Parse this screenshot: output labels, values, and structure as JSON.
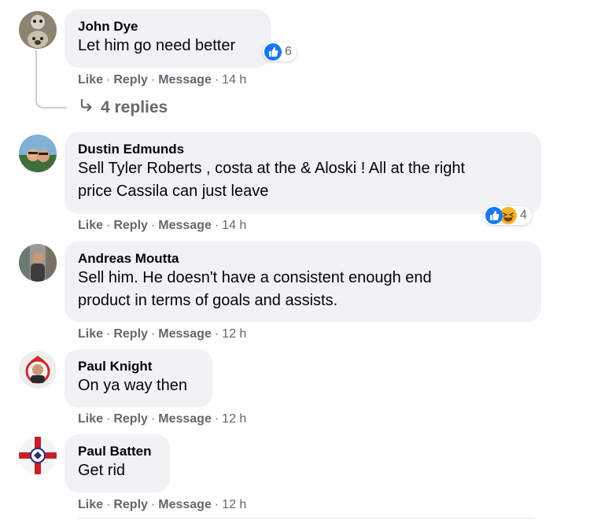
{
  "actions": {
    "like": "Like",
    "reply": "Reply",
    "message": "Message",
    "dot": "·"
  },
  "colors": {
    "bubble": "#f0f2f5",
    "meta": "#65676b",
    "like_blue": "#1877f2",
    "haha_yellow": "#f7b125"
  },
  "comments": [
    {
      "author": "John Dye",
      "text": "Let him go need better",
      "time": "14 h",
      "reactions": {
        "icons": [
          "like-icon"
        ],
        "count": "6"
      },
      "replies_label": "4 replies",
      "replies_icon": "reply-arrow-icon"
    },
    {
      "author": "Dustin Edmunds",
      "line1": "Sell Tyler Roberts , costa at the & Aloski ! All at the right",
      "line2": "price Cassila can just leave",
      "time": "14 h",
      "reactions": {
        "icons": [
          "like-icon",
          "haha-icon"
        ],
        "count": "4"
      }
    },
    {
      "author": "Andreas Moutta",
      "line1": "Sell him. He doesn't have a consistent enough end",
      "line2": "product in terms of goals and assists.",
      "time": "12 h"
    },
    {
      "author": "Paul Knight",
      "text": "On ya way then",
      "time": "12 h"
    },
    {
      "author": "Paul Batten",
      "text": "Get rid",
      "time": "12 h"
    }
  ]
}
